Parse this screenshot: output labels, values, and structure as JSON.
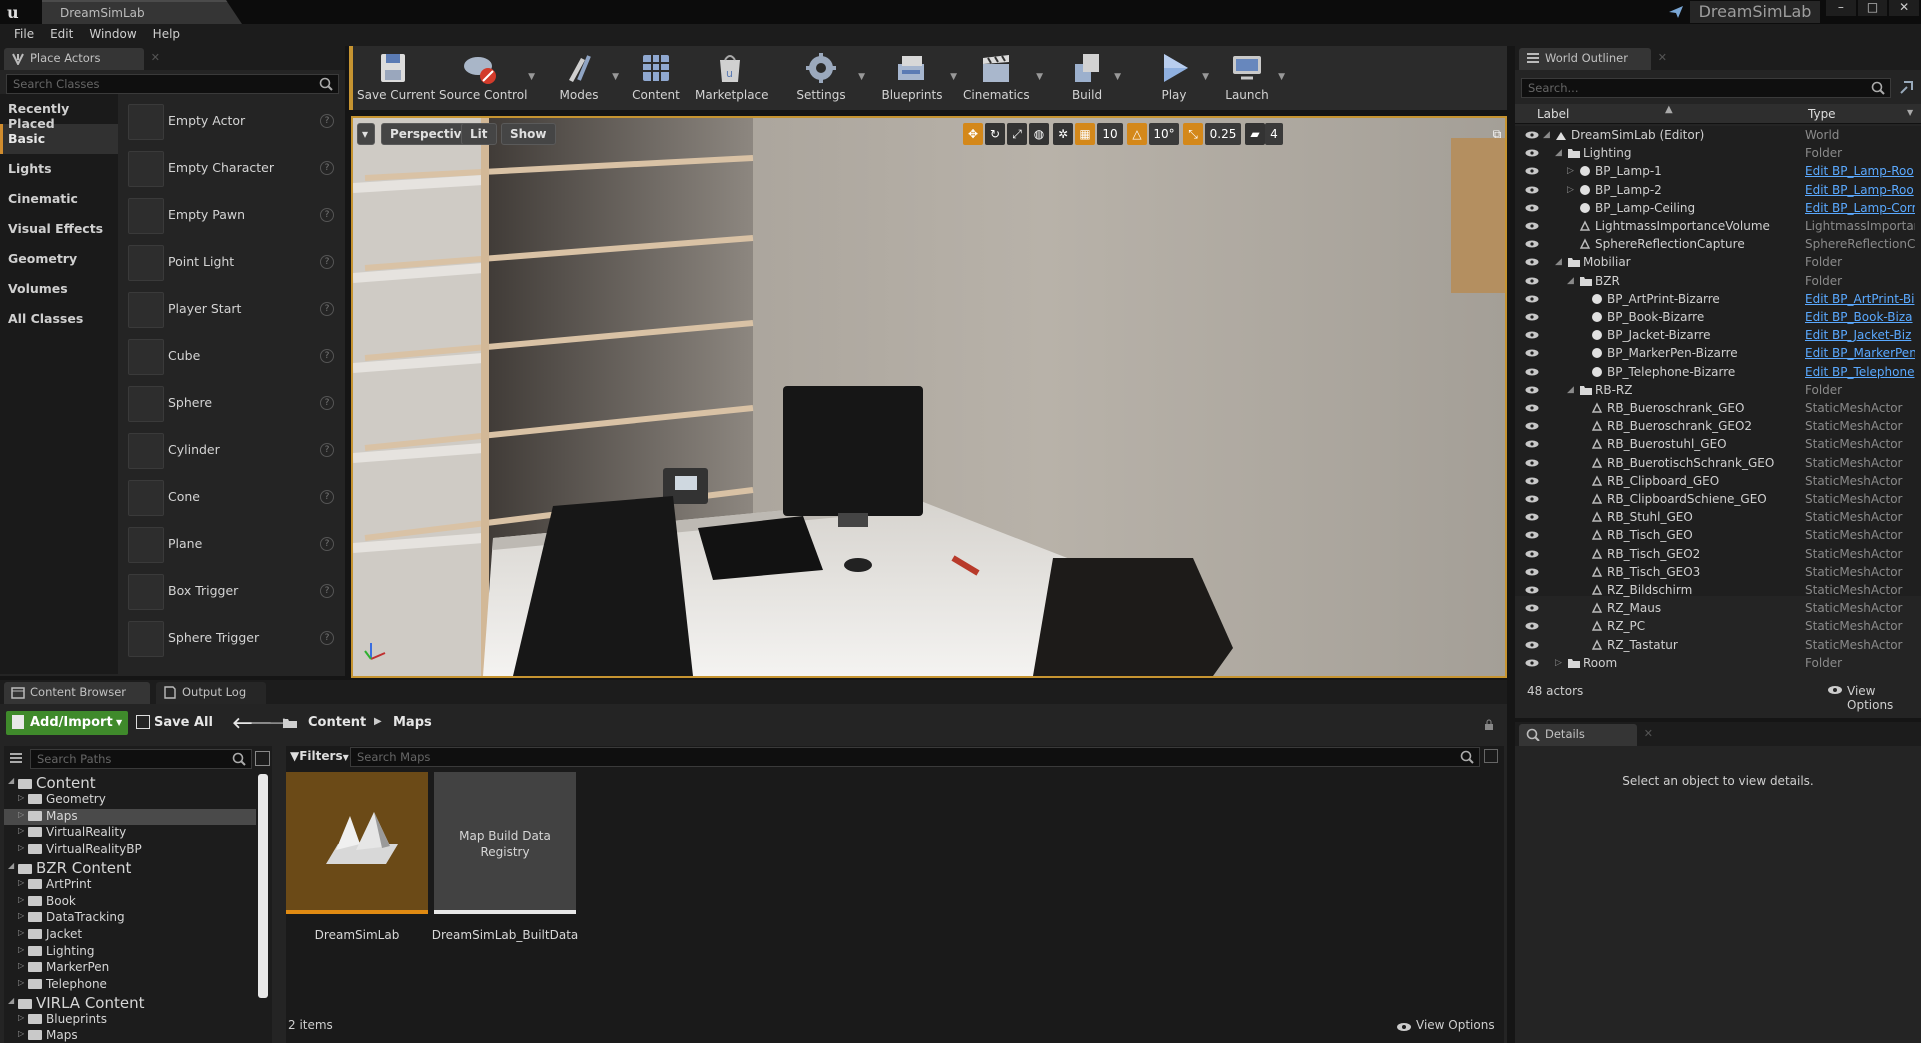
{
  "window": {
    "doc_tab": "DreamSimLab",
    "project_name": "DreamSimLab",
    "menu": [
      "File",
      "Edit",
      "Window",
      "Help"
    ]
  },
  "place_actors": {
    "tab": "Place Actors",
    "search_placeholder": "Search Classes",
    "categories": [
      "Recently Placed",
      "Basic",
      "Lights",
      "Cinematic",
      "Visual Effects",
      "Geometry",
      "Volumes",
      "All Classes"
    ],
    "selected_category": "Basic",
    "actors": [
      "Empty Actor",
      "Empty Character",
      "Empty Pawn",
      "Point Light",
      "Player Start",
      "Cube",
      "Sphere",
      "Cylinder",
      "Cone",
      "Plane",
      "Box Trigger",
      "Sphere Trigger"
    ]
  },
  "toolbar": {
    "buttons": [
      "Save Current",
      "Source Control",
      "Modes",
      "Content",
      "Marketplace",
      "Settings",
      "Blueprints",
      "Cinematics",
      "Build",
      "Play",
      "Launch"
    ]
  },
  "viewport": {
    "perspective": "Perspective",
    "lit": "Lit",
    "show": "Show",
    "grid_snap": "10",
    "rotation_snap": "10°",
    "scale_snap": "0.25",
    "camera_speed": "4"
  },
  "outliner": {
    "tab": "World Outliner",
    "search_placeholder": "Search...",
    "col_label": "Label",
    "col_type": "Type",
    "rows": [
      {
        "label": "DreamSimLab (Editor)",
        "type": "World",
        "link": false
      },
      {
        "label": "Lighting",
        "type": "Folder",
        "link": false
      },
      {
        "label": "BP_Lamp-1",
        "type": "Edit BP_Lamp-Roo",
        "link": true
      },
      {
        "label": "BP_Lamp-2",
        "type": "Edit BP_Lamp-Roo",
        "link": true
      },
      {
        "label": "BP_Lamp-Ceiling",
        "type": "Edit BP_Lamp-Corr",
        "link": true
      },
      {
        "label": "LightmassImportanceVolume",
        "type": "LightmassImportanc",
        "link": false
      },
      {
        "label": "SphereReflectionCapture",
        "type": "SphereReflectionCap",
        "link": false
      },
      {
        "label": "Mobiliar",
        "type": "Folder",
        "link": false
      },
      {
        "label": "BZR",
        "type": "Folder",
        "link": false
      },
      {
        "label": "BP_ArtPrint-Bizarre",
        "type": "Edit BP_ArtPrint-Bi",
        "link": true
      },
      {
        "label": "BP_Book-Bizarre",
        "type": "Edit BP_Book-Biza",
        "link": true
      },
      {
        "label": "BP_Jacket-Bizarre",
        "type": "Edit BP_Jacket-Biz",
        "link": true
      },
      {
        "label": "BP_MarkerPen-Bizarre",
        "type": "Edit BP_MarkerPen",
        "link": true
      },
      {
        "label": "BP_Telephone-Bizarre",
        "type": "Edit BP_Telephone",
        "link": true
      },
      {
        "label": "RB-RZ",
        "type": "Folder",
        "link": false
      },
      {
        "label": "RB_Bueroschrank_GEO",
        "type": "StaticMeshActor",
        "link": false
      },
      {
        "label": "RB_Bueroschrank_GEO2",
        "type": "StaticMeshActor",
        "link": false
      },
      {
        "label": "RB_Buerostuhl_GEO",
        "type": "StaticMeshActor",
        "link": false
      },
      {
        "label": "RB_BuerotischSchrank_GEO",
        "type": "StaticMeshActor",
        "link": false
      },
      {
        "label": "RB_Clipboard_GEO",
        "type": "StaticMeshActor",
        "link": false
      },
      {
        "label": "RB_ClipboardSchiene_GEO",
        "type": "StaticMeshActor",
        "link": false
      },
      {
        "label": "RB_Stuhl_GEO",
        "type": "StaticMeshActor",
        "link": false
      },
      {
        "label": "RB_Tisch_GEO",
        "type": "StaticMeshActor",
        "link": false
      },
      {
        "label": "RB_Tisch_GEO2",
        "type": "StaticMeshActor",
        "link": false
      },
      {
        "label": "RB_Tisch_GEO3",
        "type": "StaticMeshActor",
        "link": false
      },
      {
        "label": "RZ_Bildschirm",
        "type": "StaticMeshActor",
        "link": false
      },
      {
        "label": "RZ_Maus",
        "type": "StaticMeshActor",
        "link": false
      },
      {
        "label": "RZ_PC",
        "type": "StaticMeshActor",
        "link": false
      },
      {
        "label": "RZ_Tastatur",
        "type": "StaticMeshActor",
        "link": false
      },
      {
        "label": "Room",
        "type": "Folder",
        "link": false
      }
    ],
    "actor_count": "48 actors",
    "view_options": "View Options"
  },
  "details": {
    "tab": "Details",
    "empty_text": "Select an object to view details."
  },
  "content_browser": {
    "tab": "Content Browser",
    "output_tab": "Output Log",
    "add_import": "Add/Import",
    "save_all": "Save All",
    "breadcrumb": [
      "Content",
      "Maps"
    ],
    "search_paths_placeholder": "Search Paths",
    "filters": "Filters",
    "search_placeholder": "Search Maps",
    "tree": [
      {
        "label": "Content",
        "level": 0,
        "big": true
      },
      {
        "label": "Geometry",
        "level": 1
      },
      {
        "label": "Maps",
        "level": 1,
        "selected": true
      },
      {
        "label": "VirtualReality",
        "level": 1
      },
      {
        "label": "VirtualRealityBP",
        "level": 1
      },
      {
        "label": "BZR Content",
        "level": 0,
        "big": true
      },
      {
        "label": "ArtPrint",
        "level": 1
      },
      {
        "label": "Book",
        "level": 1
      },
      {
        "label": "DataTracking",
        "level": 1
      },
      {
        "label": "Jacket",
        "level": 1
      },
      {
        "label": "Lighting",
        "level": 1
      },
      {
        "label": "MarkerPen",
        "level": 1
      },
      {
        "label": "Telephone",
        "level": 1
      },
      {
        "label": "VIRLA Content",
        "level": 0,
        "big": true
      },
      {
        "label": "Blueprints",
        "level": 1
      },
      {
        "label": "Maps",
        "level": 1
      }
    ],
    "assets": [
      {
        "name": "DreamSimLab",
        "thumb_text": ""
      },
      {
        "name": "DreamSimLab_BuiltData",
        "thumb_text": "Map Build Data Registry"
      }
    ],
    "item_count": "2 items",
    "view_options": "View Options"
  }
}
